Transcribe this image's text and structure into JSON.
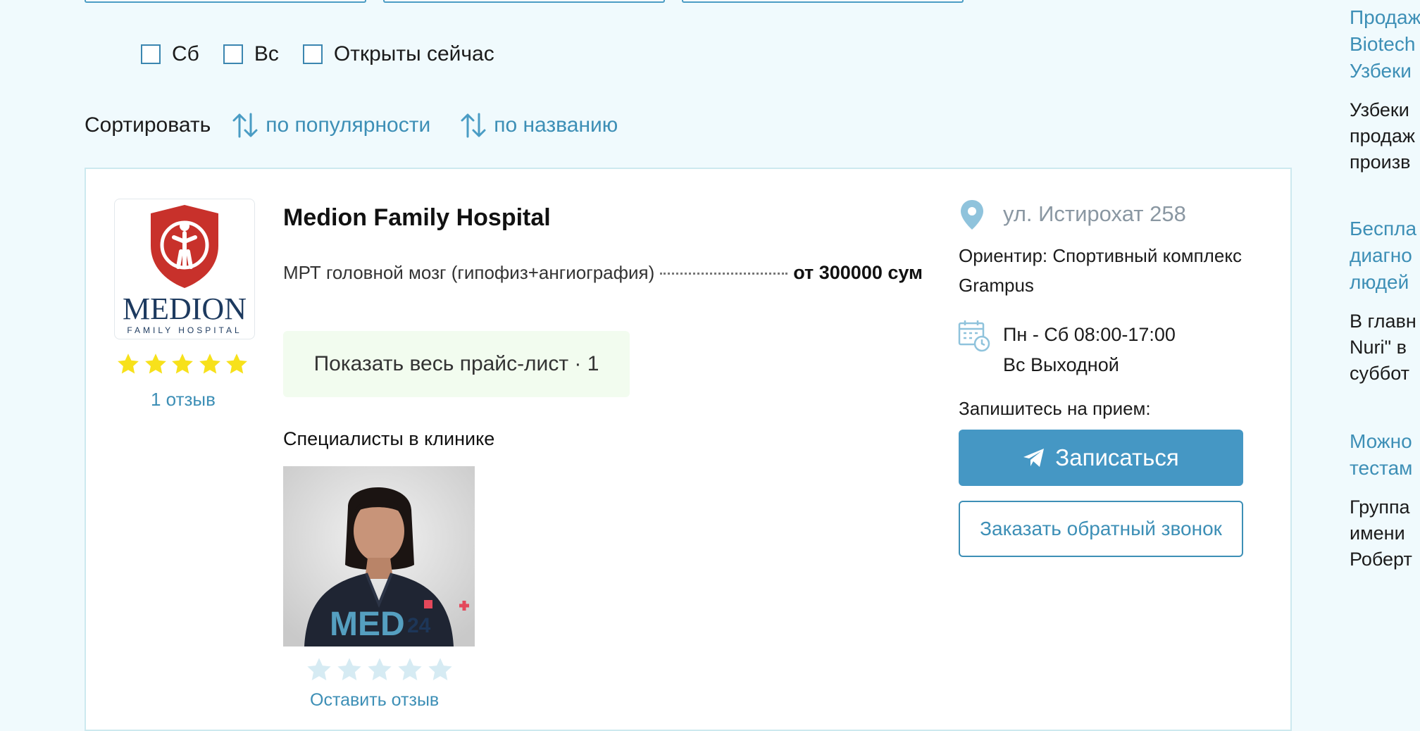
{
  "filters": {
    "days": [
      {
        "label": "Сб",
        "checked": false
      },
      {
        "label": "Вс",
        "checked": false
      },
      {
        "label": "Открыты сейчас",
        "checked": false
      }
    ]
  },
  "sort": {
    "label": "Сортировать",
    "options": [
      "по популярности",
      "по названию"
    ]
  },
  "clinic": {
    "logo_text": "MEDION",
    "logo_subtext": "FAMILY HOSPITAL",
    "rating": 5,
    "reviews_label": "1 отзыв",
    "name": "Medion Family Hospital",
    "service": {
      "name": "МРТ головной мозг (гипофиз+ангиография)",
      "price": "от 300000 сум"
    },
    "pricelist_button": "Показать весь прайс-лист · 1",
    "specialists_title": "Специалисты в клинике",
    "specialist": {
      "watermark": "MED",
      "watermark_num": "24",
      "rating": 0,
      "review_link": "Оставить отзыв"
    },
    "address": "ул. Истирохат 258",
    "landmark": "Ориентир: Спортивный комплекс Grampus",
    "hours": [
      "Пн - Сб 08:00-17:00",
      "Вс Выходной"
    ],
    "book_label": "Запишитесь на прием:",
    "book_button": "Записаться",
    "callback_button": "Заказать обратный звонок"
  },
  "sidebar_news": [
    {
      "title_lines": [
        "Продаж",
        "Biotech",
        "Узбеки"
      ],
      "text_lines": [
        "Узбеки",
        "продаж",
        "произв"
      ]
    },
    {
      "title_lines": [
        "Беспла",
        "диагно",
        "людей"
      ],
      "text_lines": [
        "В главн",
        "Nuri\" в",
        "суббот"
      ]
    },
    {
      "title_lines": [
        "Можно",
        "тестам"
      ],
      "text_lines": [
        "Группа",
        "имени",
        "Роберт"
      ]
    }
  ],
  "colors": {
    "accent": "#4597c4",
    "link": "#3d8fb6",
    "star_active": "#f7e11b",
    "star_inactive": "#d6ebf3",
    "logo_red": "#c8312b",
    "logo_navy": "#1d3a5f",
    "pricelist_bg": "#f2fcef"
  }
}
